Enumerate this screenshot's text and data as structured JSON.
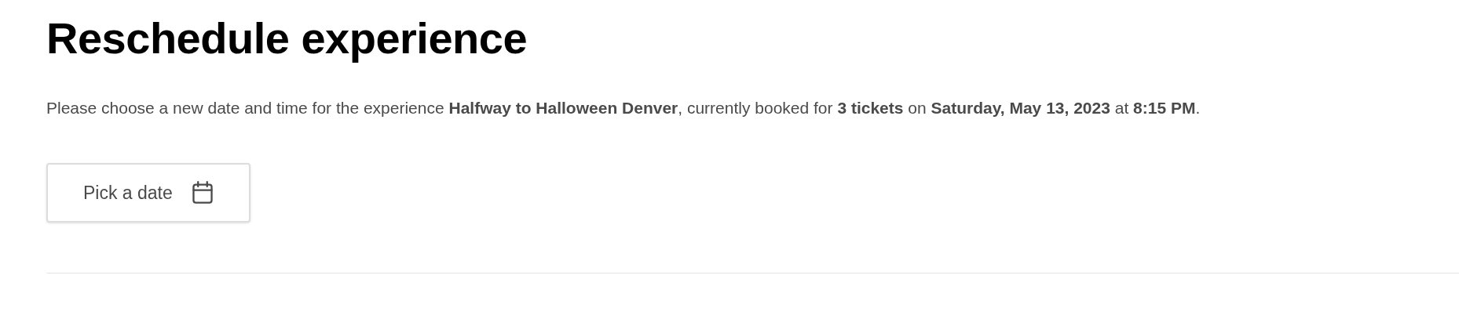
{
  "title": "Reschedule experience",
  "description": "Please choose a new date and time for the experience **Halfway to Halloween Denver**, currently booked for **3 tickets** on **Saturday, May 13, 2023** at **8:15 PM**.",
  "date_button": {
    "label": "Pick a date"
  }
}
